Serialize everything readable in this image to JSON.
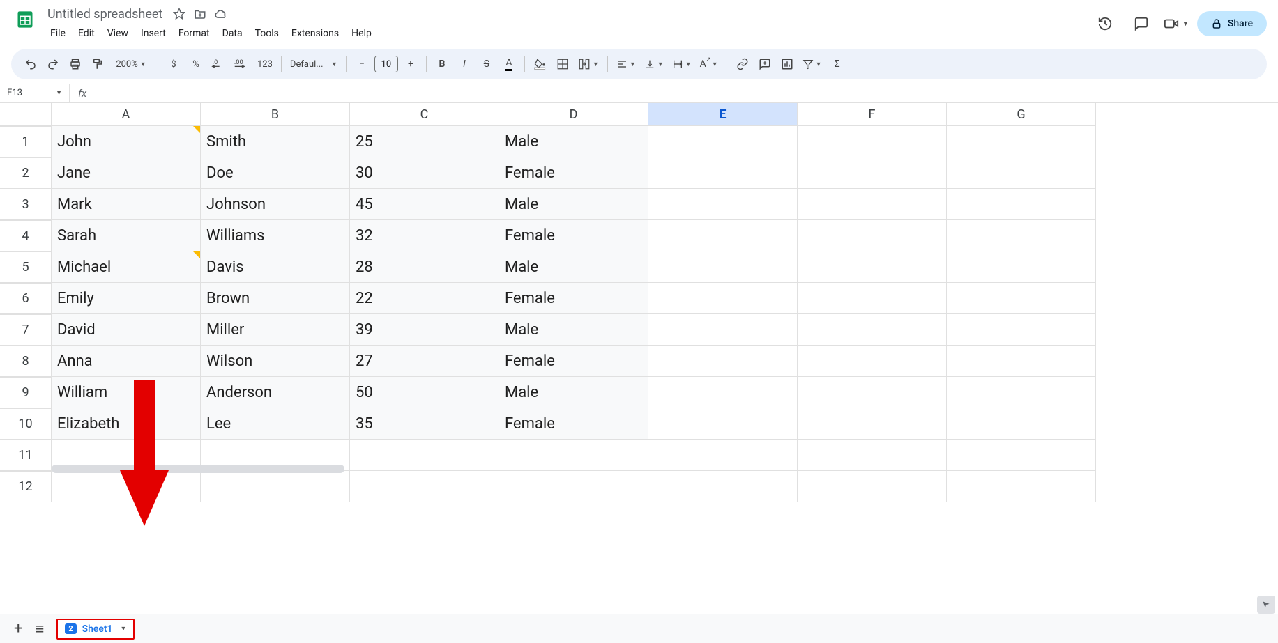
{
  "doc": {
    "title": "Untitled spreadsheet"
  },
  "menus": [
    "File",
    "Edit",
    "View",
    "Insert",
    "Format",
    "Data",
    "Tools",
    "Extensions",
    "Help"
  ],
  "share": "Share",
  "zoom": "200%",
  "font_name": "Defaul...",
  "font_size": "10",
  "namebox": "E13",
  "columns": [
    "A",
    "B",
    "C",
    "D",
    "E",
    "F",
    "G"
  ],
  "selected_col": "E",
  "rows": [
    "1",
    "2",
    "3",
    "4",
    "5",
    "6",
    "7",
    "8",
    "9",
    "10",
    "11",
    "12"
  ],
  "data": [
    [
      "John",
      "Smith",
      "25",
      "Male"
    ],
    [
      "Jane",
      "Doe",
      "30",
      "Female"
    ],
    [
      "Mark",
      "Johnson",
      "45",
      "Male"
    ],
    [
      "Sarah",
      "Williams",
      "32",
      "Female"
    ],
    [
      "Michael",
      "Davis",
      "28",
      "Male"
    ],
    [
      "Emily",
      "Brown",
      "22",
      "Female"
    ],
    [
      "David",
      "Miller",
      "39",
      "Male"
    ],
    [
      "Anna",
      "Wilson",
      "27",
      "Female"
    ],
    [
      "William",
      "Anderson",
      "50",
      "Male"
    ],
    [
      "Elizabeth",
      "Lee",
      "35",
      "Female"
    ]
  ],
  "note_cells": [
    "A1",
    "A5"
  ],
  "sheet": {
    "badge": "2",
    "name": "Sheet1"
  },
  "toolbar_labels": {
    "currency": "$",
    "percent": "%",
    "dec_dec": ".0",
    "inc_dec": ".00",
    "num": "123"
  }
}
